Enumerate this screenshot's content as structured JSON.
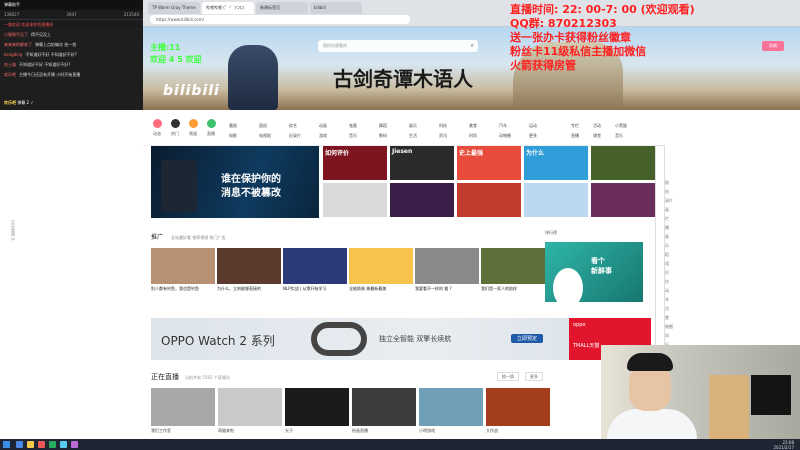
{
  "browser": {
    "tabs": [
      "TP Warm Gray Theme",
      "哔哩哔哩 (゜-゜)つロ",
      "新建标签页",
      "bilibili"
    ],
    "address": "https://www.bilibili.com/"
  },
  "chat": {
    "title": "弹幕助手",
    "stats": [
      "138027",
      "3947",
      "213540"
    ],
    "notice": "一路欢迎 欢迎来你到直播间",
    "messages": [
      {
        "name": "小猫咪不见了",
        "text": "得不见没上"
      },
      {
        "name": "来来来的都来了",
        "text": "弹幕上点拍嘛次 拍一拍"
      },
      {
        "name": "kongding",
        "text": "不知道好不好 不知道好不好?"
      },
      {
        "name": "吃土喵",
        "text": "不知道好不好 不知道好不好?"
      },
      {
        "name": "欢乐吧",
        "text": "主播今日还没有开播 小时开始直播"
      }
    ],
    "bottom_label": "欢乐吧",
    "bottom_text": "弹幕 2 ✓"
  },
  "overlay": {
    "green_line1": "主播:11",
    "green_line2": "欢迎 4 5 欢迎",
    "red_lines": [
      "直播时间: 22: 00-7: 00 (欢迎观看)",
      "QQ群: 870212303",
      "送一张办卡获得粉丝徽章",
      "粉丝卡11级私信主播加微信",
      "火箭获得房管"
    ]
  },
  "banner": {
    "logo": "bilibili",
    "campaign_title": "古剑奇谭木语人",
    "search_placeholder": "搜你所想看的",
    "upload_label": "投稿"
  },
  "nav": {
    "circles": [
      "动态",
      "热门",
      "频道",
      "直播"
    ],
    "categories": [
      [
        "番剧",
        "国创",
        "综艺",
        "动画",
        "鬼畜",
        "舞蹈",
        "娱乐",
        "科技",
        "美食",
        "汽车",
        "运动"
      ],
      [
        "电影",
        "电视剧",
        "纪录片",
        "游戏",
        "音乐",
        "数码",
        "生活",
        "资讯",
        "时尚",
        "动物圈",
        "更多"
      ]
    ],
    "extra": [
      "专栏",
      "活动",
      "小黑屋",
      "直播",
      "课堂",
      "音乐"
    ]
  },
  "hero": {
    "line1": "谁在保护你的",
    "line2": "消息不被篡改"
  },
  "thumbs": [
    {
      "label": "如何评价",
      "color": "#7d1420"
    },
    {
      "label": "Jiesen",
      "color": "#2a2a2a"
    },
    {
      "label": "史上最强",
      "color": "#e74c3c"
    },
    {
      "label": "为什么",
      "color": "#2f9ed8"
    },
    {
      "label": "",
      "color": "#46602a"
    },
    {
      "label": "",
      "color": "#d9d9d9"
    },
    {
      "label": "",
      "color": "#3a1f4b"
    },
    {
      "label": "",
      "color": "#c23d2d"
    },
    {
      "label": "",
      "color": "#bcd7f0"
    },
    {
      "label": "",
      "color": "#6b2d5b"
    }
  ],
  "section": {
    "title": "推广",
    "sub": "全站最好看 推荐视频 热门广告"
  },
  "cards": [
    {
      "title": "别人都有钓鱼，我也是钓鱼",
      "color": "#b89073"
    },
    {
      "title": "为什么，立刻能够直接的",
      "color": "#5c3a2e"
    },
    {
      "title": "NLP实战 | 从零开始学习",
      "color": "#2d3a7a"
    },
    {
      "title": "全能换装 做最新最美",
      "color": "#f7c34a"
    },
    {
      "title": "我要看不一样的 猫 ?",
      "color": "#8a8a8a"
    },
    {
      "title": "我们是一家人的陪伴",
      "color": "#5e6f3a"
    }
  ],
  "rank": {
    "header": "排行榜",
    "text1": "看个",
    "text2": "新鲜事"
  },
  "ad": {
    "brand": "OPPO Watch 2 系列",
    "slogan": "独立全智能  双擎长续航",
    "button": "立即预定",
    "oppo_label": "oppo",
    "mall": "TMALL天猫"
  },
  "live": {
    "title": "正在直播",
    "sub": "当前共有 5582 个直播间",
    "buttons": [
      "换一换",
      "更多"
    ],
    "items": [
      {
        "title": "我们工作室",
        "color": "#a8a8a8"
      },
      {
        "title": "萌猫来啦",
        "color": "#c9c9c9"
      },
      {
        "title": "光子",
        "color": "#1b1b1b"
      },
      {
        "title": "绘画直播",
        "color": "#3d3d3d"
      },
      {
        "title": "小明游戏",
        "color": "#6fa0b8"
      },
      {
        "title": "大作战",
        "color": "#a33d1e"
      }
    ]
  },
  "sidebar_links": [
    "番剧",
    "国创",
    "纪录片",
    "漫画",
    "专栏",
    "直播",
    "动画",
    "音乐",
    "舞蹈",
    "游戏",
    "知识",
    "科技",
    "运动",
    "汽车",
    "生活",
    "美食",
    "动物圈",
    "时尚",
    "娱乐",
    "影视",
    "电影",
    "电视剧"
  ],
  "taskbar": {
    "time": "23:08",
    "date": "2021/2/17"
  },
  "left_rail": {
    "label": "正在直播 中"
  },
  "webcam_label": "webcam"
}
